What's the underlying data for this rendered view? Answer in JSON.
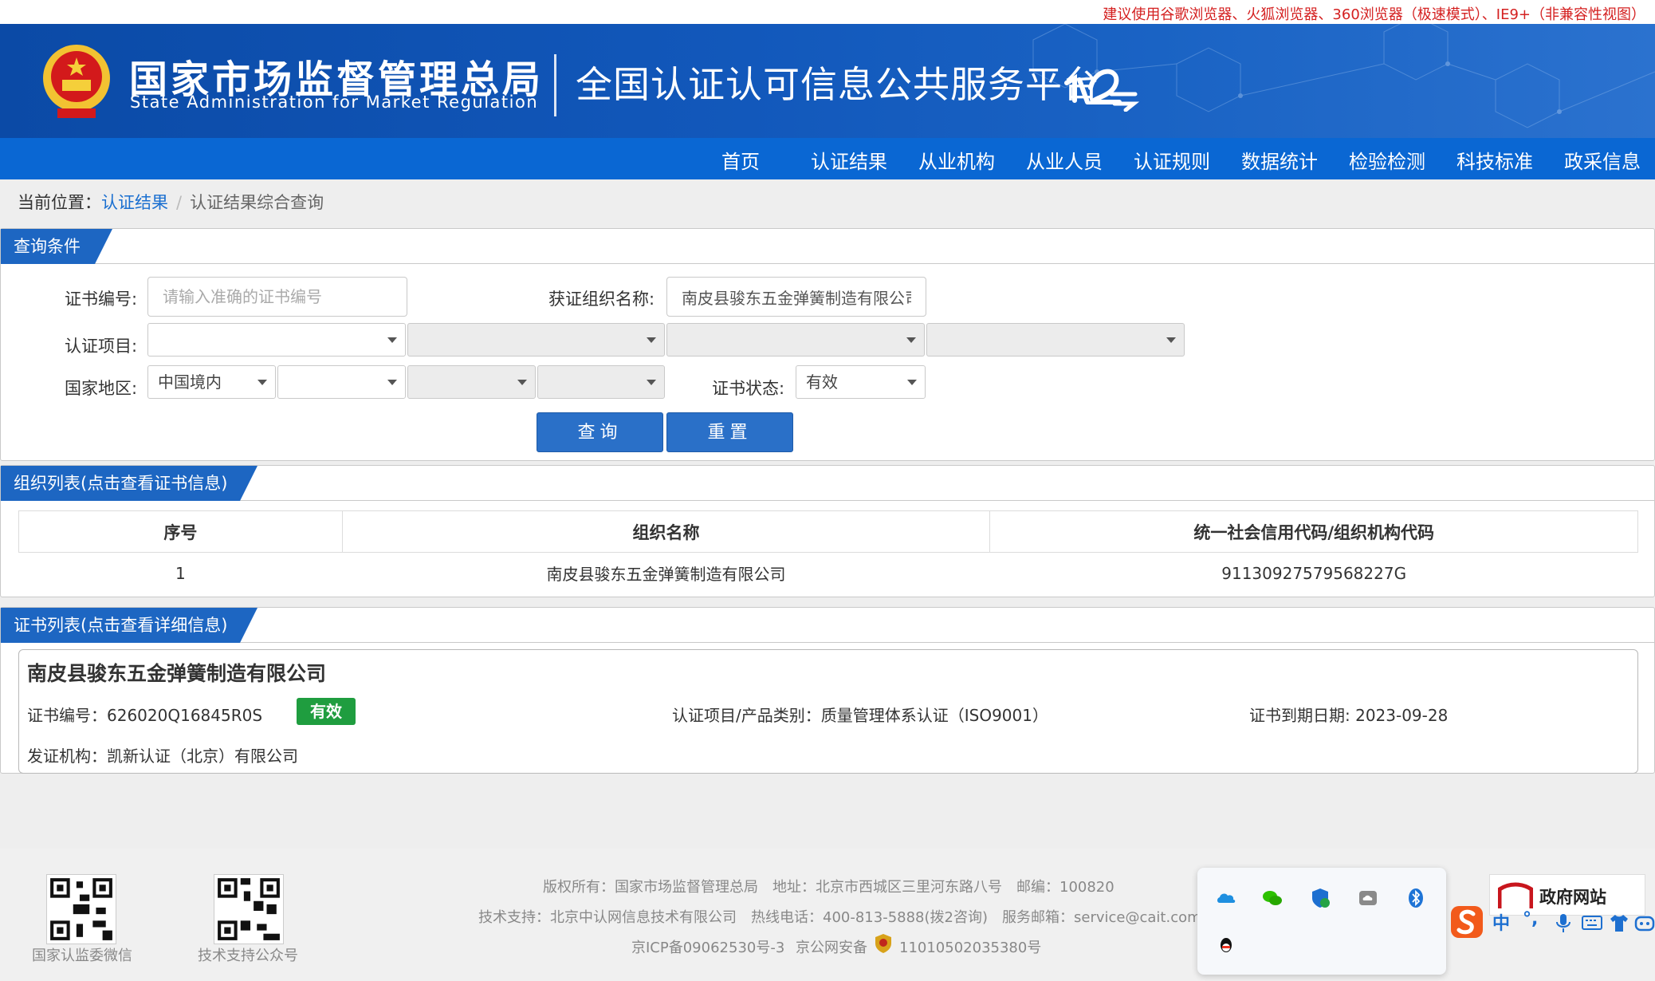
{
  "notice": "建议使用谷歌浏览器、火狐浏览器、360浏览器（极速模式）、IE9+（非兼容性视图）",
  "header": {
    "agency_cn": "国家市场监督管理总局",
    "agency_en": "State Administration for Market Regulation",
    "platform_title": "全国认证认可信息公共服务平台"
  },
  "nav": [
    "首页",
    "认证结果",
    "从业机构",
    "从业人员",
    "认证规则",
    "数据统计",
    "检验检测",
    "科技标准",
    "政采信息"
  ],
  "breadcrumb": {
    "prefix": "当前位置：",
    "link": "认证结果",
    "current": "认证结果综合查询"
  },
  "query": {
    "section_title": "查询条件",
    "cert_no_label": "证书编号:",
    "cert_no_placeholder": "请输入准确的证书编号",
    "org_name_label": "获证组织名称:",
    "org_name_value": "南皮县骏东五金弹簧制造有限公司",
    "project_label": "认证项目:",
    "region_label": "国家地区:",
    "region_value": "中国境内",
    "status_label": "证书状态:",
    "status_value": "有效",
    "search_button": "查询",
    "reset_button": "重置"
  },
  "org_list": {
    "section_title": "组织列表(点击查看证书信息)",
    "columns": [
      "序号",
      "组织名称",
      "统一社会信用代码/组织机构代码"
    ],
    "rows": [
      [
        "1",
        "南皮县骏东五金弹簧制造有限公司",
        "91130927579568227G"
      ]
    ]
  },
  "cert_list": {
    "section_title": "证书列表(点击查看详细信息)",
    "company": "南皮县骏东五金弹簧制造有限公司",
    "cert_no": "证书编号：626020Q16845R0S",
    "status_badge": "有效",
    "project": "认证项目/产品类别：质量管理体系认证（ISO9001）",
    "expiry": "证书到期日期: 2023-09-28",
    "issuer": "发证机构：凯新认证（北京）有限公司"
  },
  "footer": {
    "qr1_caption": "国家认监委微信",
    "qr2_caption": "技术支持公众号",
    "line1": "版权所有：国家市场监督管理总局　地址：北京市西城区三里河东路八号　邮编：100820",
    "line2": "技术支持：北京中认网信息技术有限公司　热线电话：400-813-5888(拨2咨询)　服务邮箱：service@cait.com",
    "icp": "京ICP备09062530号-3",
    "police": "京公网安备",
    "police_no": "11010502035380号",
    "gov_badge": "政府网站"
  },
  "ime": [
    "中",
    "°,"
  ],
  "colors": {
    "nav_bg": "#0a67d3",
    "panel_tab": "#1d66c2",
    "status_green": "#1f9d3f",
    "notice_red": "#d42020"
  }
}
